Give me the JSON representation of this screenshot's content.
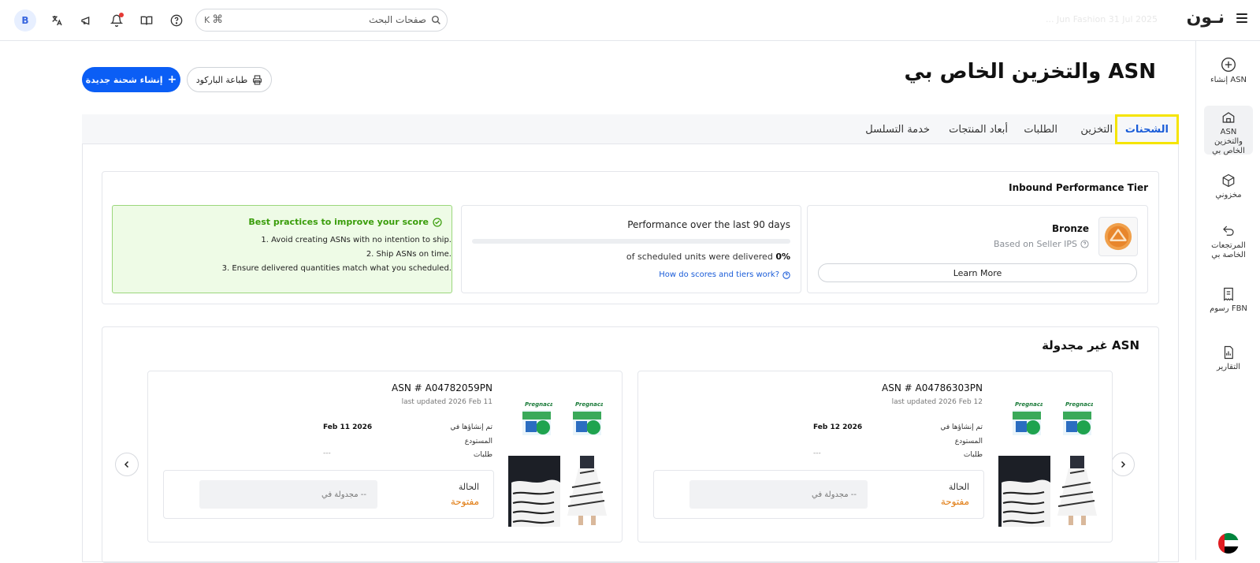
{
  "topbar": {
    "logo": "نـون",
    "faded_text": "... Jun Fashion 31 Jul 2025",
    "search_placeholder": "صفحات البحث",
    "search_shortcut": "K",
    "avatar_letter": "B"
  },
  "sidebar": {
    "items": [
      {
        "label": "إنشاء ASN",
        "icon": "plus-circle-icon"
      },
      {
        "label": "ASN والتخزين الخاص بي",
        "icon": "warehouse-icon"
      },
      {
        "label": "مخزوني",
        "icon": "box-icon"
      },
      {
        "label": "المرتجعات الخاصة بي",
        "icon": "return-icon"
      },
      {
        "label": "رسوم FBN",
        "icon": "receipt-icon"
      },
      {
        "label": "التقارير",
        "icon": "report-icon"
      }
    ]
  },
  "header": {
    "title": "ASN والتخزين الخاص بي",
    "create_button": "إنشاء شحنة جديدة",
    "print_button": "طباعة الباركود"
  },
  "tabs": [
    {
      "label": "الشحنات",
      "active": true
    },
    {
      "label": "التخزين"
    },
    {
      "label": "الطلبات"
    },
    {
      "label": "أبعاد المنتجات"
    },
    {
      "label": "خدمة التسلسل"
    }
  ],
  "performance": {
    "title": "Inbound Performance Tier",
    "tier": {
      "name": "Bronze",
      "subtitle": "Based on Seller IPS",
      "button": "Learn More"
    },
    "score": {
      "title": "Performance over the last 90 days",
      "percent": "0%",
      "progress_fraction": 0,
      "description": "of scheduled units were delivered",
      "link": "How do scores and tiers work?"
    },
    "tips": {
      "title": "Best practices to improve your score",
      "items": [
        "1. Avoid creating ASNs with no intention to ship.",
        "2. Ship ASNs on time.",
        "3. Ensure delivered quantities match what you scheduled."
      ]
    }
  },
  "unscheduled": {
    "title": "ASN غير مجدولة",
    "cards": [
      {
        "asn": "ASN # A04786303PN",
        "updated": "last updated 2026 Feb 12",
        "created_label": "تم إنشاؤها في",
        "created_value": "Feb 12 2026",
        "warehouse_label": "المستودع",
        "orders_label": "طلبات",
        "orders_value": "---",
        "status_label": "الحالة",
        "status_value": "مفتوحة",
        "scheduled_placeholder": "مجدولة في --"
      },
      {
        "asn": "ASN # A04782059PN",
        "updated": "last updated 2026 Feb 11",
        "created_label": "تم إنشاؤها في",
        "created_value": "Feb 11 2026",
        "warehouse_label": "المستودع",
        "orders_label": "طلبات",
        "orders_value": "---",
        "status_label": "الحالة",
        "status_value": "مفتوحة",
        "scheduled_placeholder": "مجدولة في --"
      }
    ]
  },
  "colors": {
    "primary": "#0b5ef5",
    "active_tab_border": "#f5e400",
    "tips_green": "#3a9d0b",
    "status_open": "#e07b11"
  }
}
